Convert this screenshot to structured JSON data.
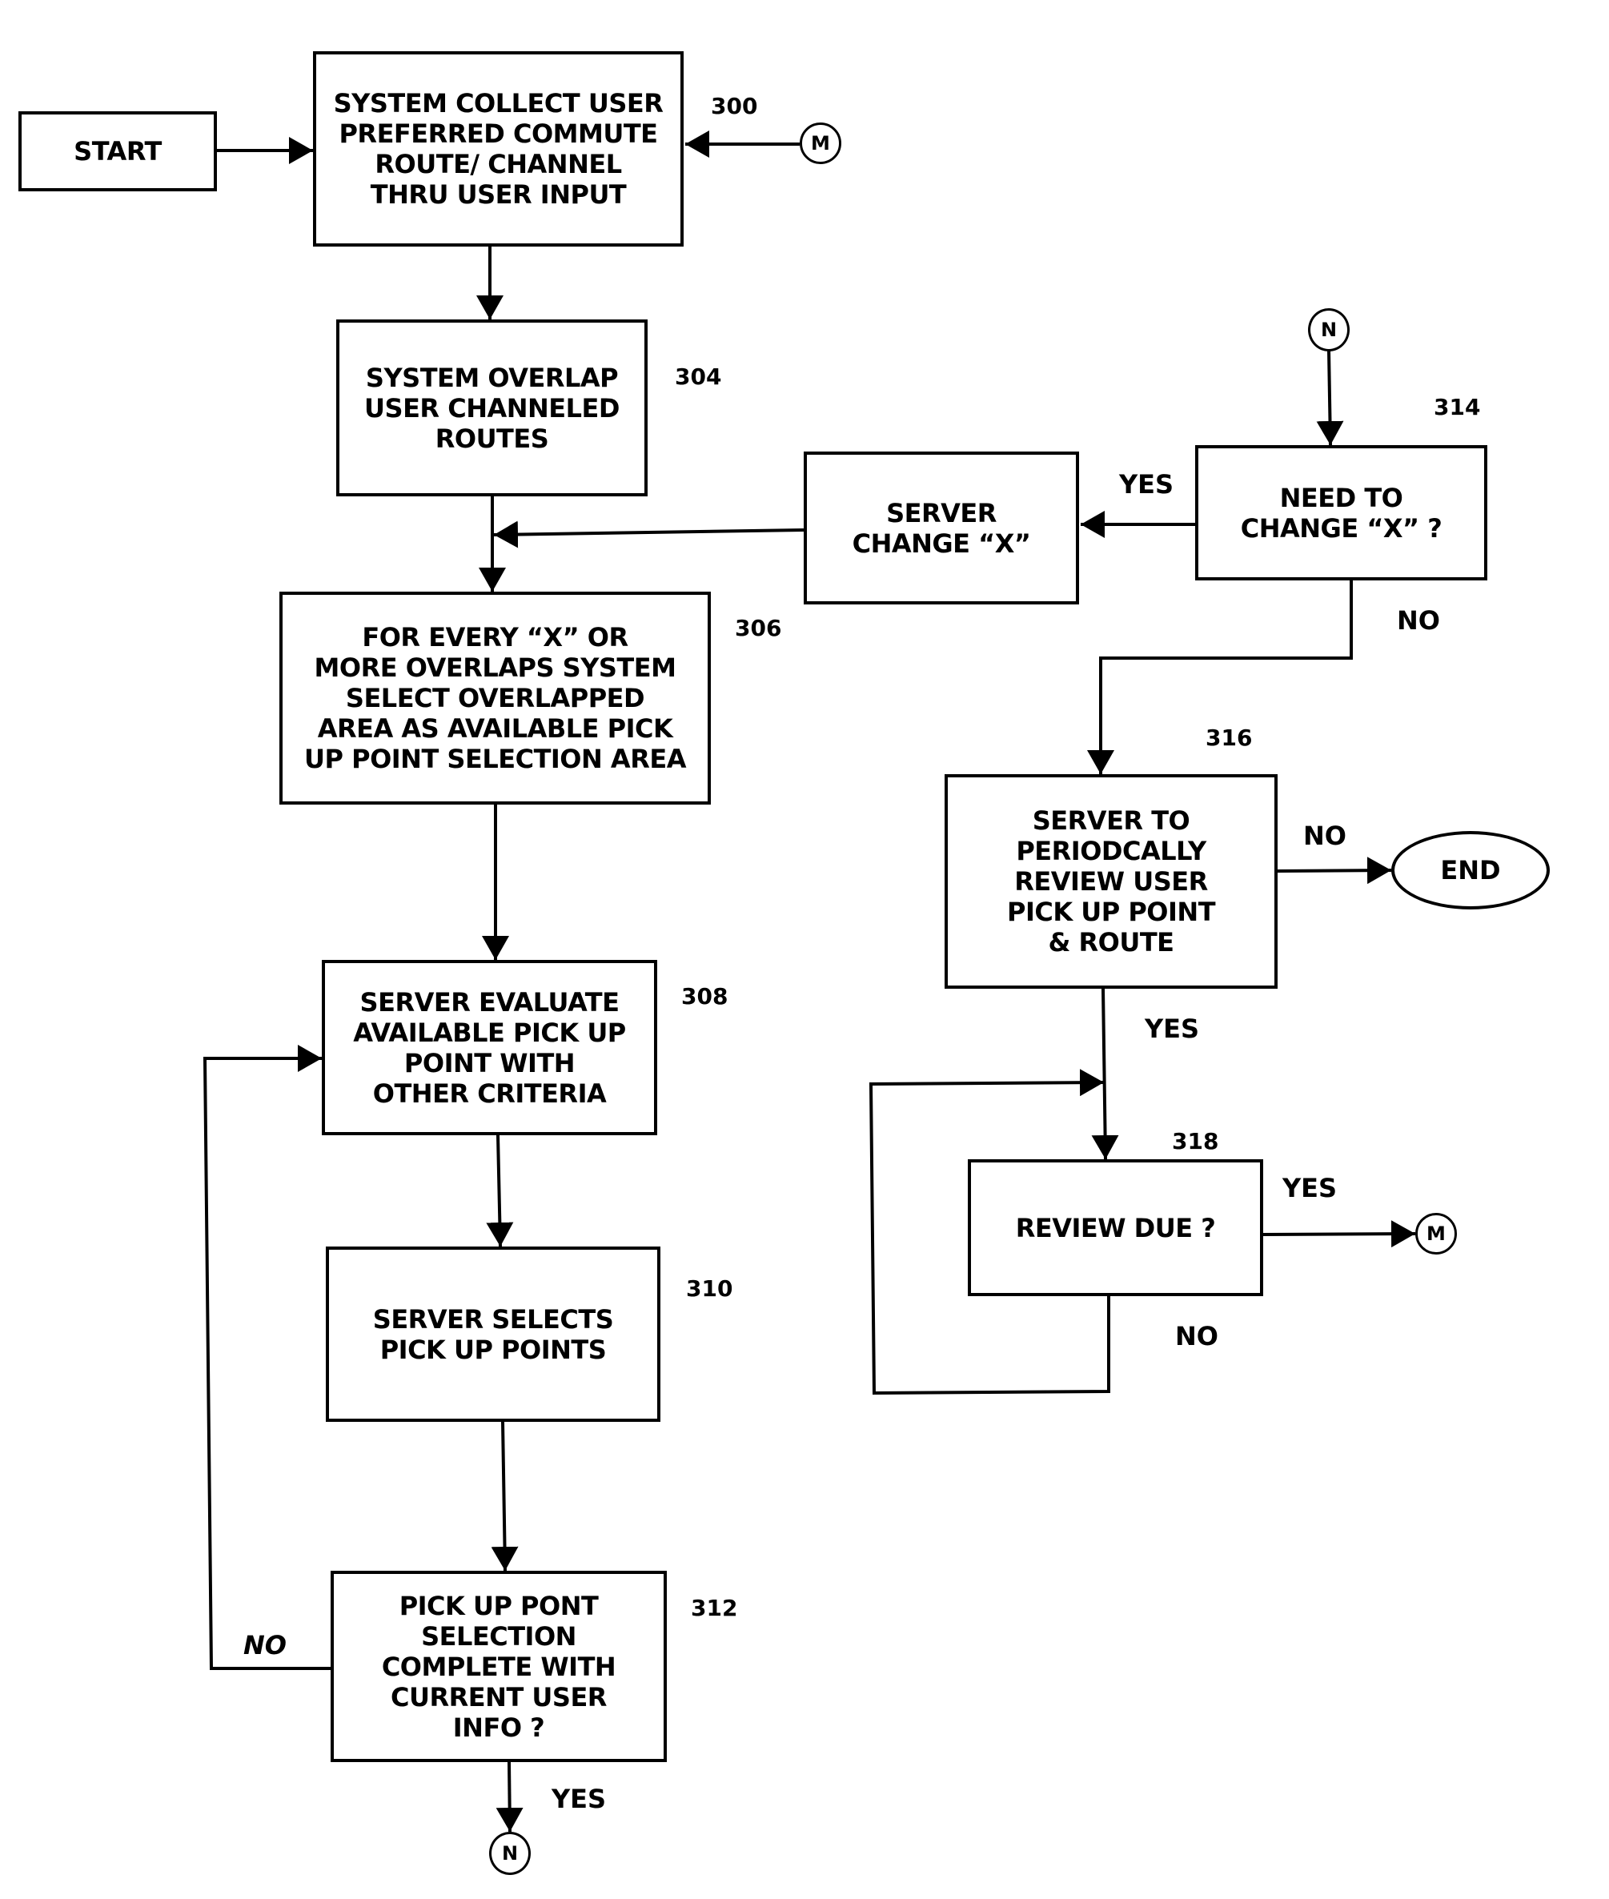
{
  "diagram": {
    "type": "flowchart",
    "colors": {
      "stroke": "#000000",
      "background": "#ffffff"
    },
    "terminals": {
      "start": "START",
      "end": "END"
    },
    "connectors": {
      "m_top": "M",
      "m_right": "M",
      "n_top": "N",
      "n_bottom": "N"
    },
    "steps": {
      "s300": {
        "ref": "300",
        "text": "SYSTEM COLLECT USER\nPREFERRED COMMUTE\nROUTE/ CHANNEL\nTHRU USER INPUT"
      },
      "s304": {
        "ref": "304",
        "text": "SYSTEM OVERLAP\nUSER CHANNELED\nROUTES"
      },
      "s306": {
        "ref": "306",
        "text": "FOR EVERY “X” OR\nMORE OVERLAPS SYSTEM\nSELECT OVERLAPPED\nAREA AS AVAILABLE PICK\nUP POINT SELECTION AREA"
      },
      "s308": {
        "ref": "308",
        "text": "SERVER EVALUATE\nAVAILABLE PICK UP\nPOINT WITH\nOTHER CRITERIA"
      },
      "s310": {
        "ref": "310",
        "text": "SERVER SELECTS\nPICK UP POINTS"
      },
      "s312": {
        "ref": "312",
        "text": "PICK UP  PONT\nSELECTION\nCOMPLETE WITH\nCURRENT USER\nINFO ?"
      },
      "server_change": {
        "text": "SERVER\nCHANGE “X”"
      },
      "s314": {
        "ref": "314",
        "text": "NEED TO\nCHANGE “X” ?"
      },
      "s316": {
        "ref": "316",
        "text": "SERVER TO\nPERIODCALLY\nREVIEW USER\nPICK UP POINT\n& ROUTE"
      },
      "s318": {
        "ref": "318",
        "text": "REVIEW DUE ?"
      }
    },
    "edge_labels": {
      "s312_no": "NO",
      "s312_yes": "YES",
      "s314_yes": "YES",
      "s314_no": "NO",
      "s316_no": "NO",
      "s316_yes": "YES",
      "s318_yes": "YES",
      "s318_no": "NO"
    }
  }
}
